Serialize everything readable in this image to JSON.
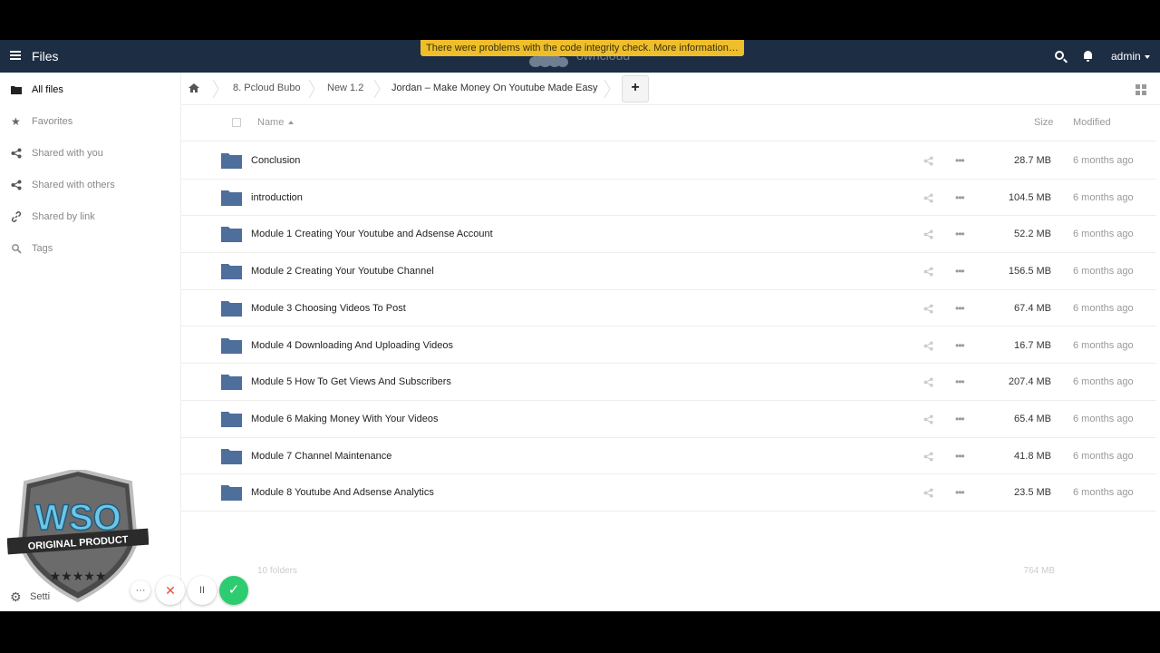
{
  "header": {
    "app_title": "Files",
    "logo_text": "owncloud",
    "warning": "There were problems with the code integrity check. More information…",
    "user": "admin"
  },
  "sidebar": {
    "items": [
      {
        "label": "All files",
        "icon": "folder-icon"
      },
      {
        "label": "Favorites",
        "icon": "star-icon"
      },
      {
        "label": "Shared with you",
        "icon": "share-icon"
      },
      {
        "label": "Shared with others",
        "icon": "share-icon"
      },
      {
        "label": "Shared by link",
        "icon": "link-icon"
      },
      {
        "label": "Tags",
        "icon": "tag-icon"
      }
    ],
    "settings_label": "Setti"
  },
  "breadcrumb": {
    "items": [
      "8. Pcloud Bubo",
      "New 1.2",
      "Jordan – Make Money On Youtube Made Easy"
    ],
    "add_label": "+"
  },
  "table": {
    "headers": {
      "name": "Name",
      "size": "Size",
      "modified": "Modified"
    },
    "rows": [
      {
        "name": "Conclusion",
        "size": "28.7 MB",
        "modified": "6 months ago"
      },
      {
        "name": "introduction",
        "size": "104.5 MB",
        "modified": "6 months ago"
      },
      {
        "name": "Module 1 Creating Your Youtube and Adsense Account",
        "size": "52.2 MB",
        "modified": "6 months ago"
      },
      {
        "name": "Module 2 Creating Your Youtube Channel",
        "size": "156.5 MB",
        "modified": "6 months ago"
      },
      {
        "name": "Module 3 Choosing Videos To Post",
        "size": "67.4 MB",
        "modified": "6 months ago"
      },
      {
        "name": "Module 4 Downloading And Uploading Videos",
        "size": "16.7 MB",
        "modified": "6 months ago"
      },
      {
        "name": "Module 5 How To Get Views And Subscribers",
        "size": "207.4 MB",
        "modified": "6 months ago"
      },
      {
        "name": "Module 6 Making Money With Your Videos",
        "size": "65.4 MB",
        "modified": "6 months ago"
      },
      {
        "name": "Module 7 Channel Maintenance",
        "size": "41.8 MB",
        "modified": "6 months ago"
      },
      {
        "name": "Module 8 Youtube And Adsense Analytics",
        "size": "23.5 MB",
        "modified": "6 months ago"
      }
    ],
    "summary_count": "10 folders",
    "summary_size": "764 MB"
  },
  "badge": {
    "top": "WSO",
    "bottom": "ORIGINAL PRODUCT"
  },
  "controls": {
    "more": "···",
    "cancel": "✕",
    "pause": "II",
    "confirm": "✓"
  },
  "colors": {
    "header_bg": "#1d2d44",
    "folder": "#4e6e9b",
    "warning_bg": "#eebe2b",
    "confirm": "#2ecc71"
  }
}
